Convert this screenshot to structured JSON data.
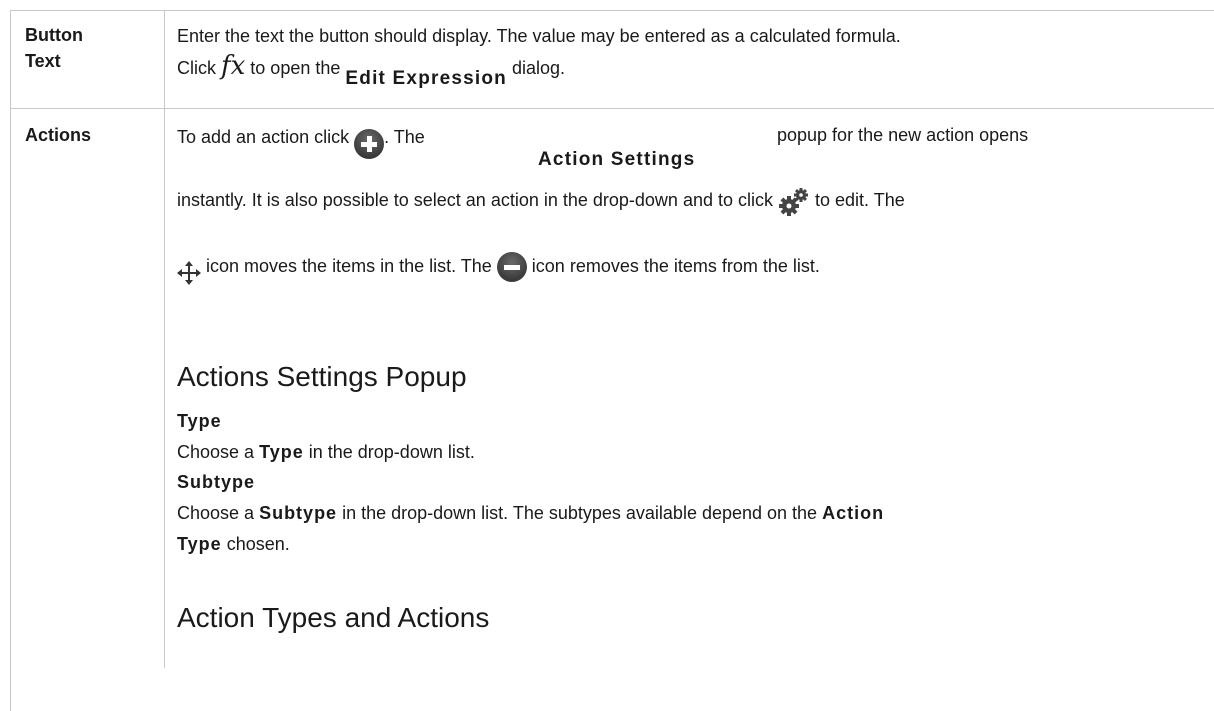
{
  "rows": [
    {
      "header_line1": "Button",
      "header_line2": "Text",
      "line1": "Enter the text the button should display. The value may be entered as a calculated formula.",
      "line2_a": "Click ",
      "fx_glyph": "fx",
      "line2_b": " to open the ",
      "edit_expression": "Edit Expression",
      "line2_c": " dialog."
    },
    {
      "header": "Actions",
      "p1_a": "To add an action click ",
      "p1_b": ". The",
      "action_settings": "Action Settings",
      "p1_c": "popup for the new action opens",
      "p2_a": "instantly. It is also possible to select an action in the drop-down and to click ",
      "p2_b": " to edit. The",
      "p3_a": " icon moves the items in the list. The ",
      "p3_b": " icon removes the items from the list.",
      "section_heading": "Actions Settings Popup",
      "type_heading": "Type",
      "type_text_a": "Choose a ",
      "type_bold": "Type",
      "type_text_b": " in the drop-down list.",
      "subtype_heading": "Subtype",
      "subtype_text_a": "Choose a  ",
      "subtype_bold": "Subtype",
      "subtype_text_b": " in the drop-down list. The subtypes available depend on the ",
      "subtype_bold2": "Action",
      "subtype_bold3": "Type",
      "subtype_text_c": " chosen.",
      "section_heading2": "Action Types and Actions"
    }
  ],
  "icons": {
    "add": "plus-circle-icon",
    "settings": "gears-icon",
    "move": "move-arrows-icon",
    "remove": "minus-circle-icon"
  }
}
